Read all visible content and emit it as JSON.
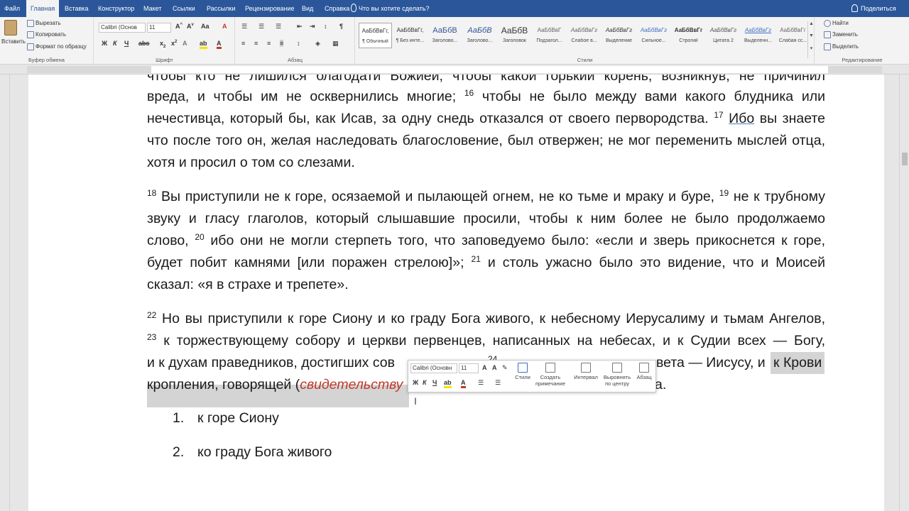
{
  "tabs": [
    {
      "label": "Файл",
      "active": false
    },
    {
      "label": "Главная",
      "active": true
    },
    {
      "label": "Вставка",
      "active": false
    },
    {
      "label": "Конструктор",
      "active": false
    },
    {
      "label": "Макет",
      "active": false
    },
    {
      "label": "Ссылки",
      "active": false
    },
    {
      "label": "Рассылки",
      "active": false
    },
    {
      "label": "Рецензирование",
      "active": false
    },
    {
      "label": "Вид",
      "active": false
    },
    {
      "label": "Справка",
      "active": false
    }
  ],
  "tell_me": "Что вы хотите сделать?",
  "share": "Поделиться",
  "clipboard": {
    "paste": "Вставить",
    "cut": "Вырезать",
    "copy": "Копировать",
    "format_painter": "Формат по образцу",
    "group_label": "Буфер обмена"
  },
  "font": {
    "family": "Calibri (Основ",
    "size": "11",
    "bold": "Ж",
    "italic": "К",
    "underline": "Ч",
    "group_label": "Шрифт"
  },
  "paragraph": {
    "group_label": "Абзац"
  },
  "styles": {
    "group_label": "Стили",
    "items": [
      {
        "preview": "АаБбВвГг,",
        "name": "¶ Обычный",
        "selected": true
      },
      {
        "preview": "АаБбВвГг,",
        "name": "¶ Без инте...",
        "selected": false
      },
      {
        "preview": "АаБбВ",
        "name": "Заголово...",
        "selected": false
      },
      {
        "preview": "АаБбВ",
        "name": "Заголово...",
        "selected": false
      },
      {
        "preview": "АаБбВ",
        "name": "Заголовок",
        "selected": false
      },
      {
        "preview": "АаБбВвГ",
        "name": "Подзагол...",
        "selected": false
      },
      {
        "preview": "АаБбВвГг",
        "name": "Слабое в...",
        "selected": false
      },
      {
        "preview": "АаБбВвГг",
        "name": "Выделение",
        "selected": false
      },
      {
        "preview": "АаБбВвГг",
        "name": "Сильное...",
        "selected": false
      },
      {
        "preview": "АаБбВвГг",
        "name": "Строгий",
        "selected": false
      },
      {
        "preview": "АаБбВвГг",
        "name": "Цитата 2",
        "selected": false
      },
      {
        "preview": "АаБбВвГг",
        "name": "Выделенн...",
        "selected": false
      },
      {
        "preview": "АаБбВвГг",
        "name": "Слабая сс...",
        "selected": false
      }
    ]
  },
  "editing": {
    "find": "Найти",
    "replace": "Заменить",
    "select": "Выделить",
    "group_label": "Редактирование"
  },
  "document": {
    "line0": "чтобы кто не лишился благодати Божией; чтобы какой горький корень, возникнув, не причинил",
    "line1a": "вреда, и чтобы им не осквернились многие; ",
    "sup16": "16",
    "line1b": " чтобы не было между вами какого блудника или",
    "line2a": "нечестивца, который бы, как Исав, за одну снедь отказался от своего первородства. ",
    "sup17": "17",
    "line2b": "Ибо",
    "line2c": " вы знаете",
    "line3": "что после того он, желая наследовать благословение, был отвержен; не мог переменить мыслей отца,",
    "line4": "хотя и просил о том со слезами.",
    "sup18": "18",
    "line5a": " Вы приступили не к горе, осязаемой и пылающей огнем, не ко тьме и мраку и буре, ",
    "sup19": "19",
    "line5b": " не к трубному",
    "line6": "звуку и гласу глаголов, который слышавшие просили, чтобы к ним более не было продолжаемо",
    "line7a": "слово, ",
    "sup20": "20",
    "line7b": " ибо они не могли стерпеть того, что заповедуемо было: «если и зверь прикоснется к горе,",
    "line8a": "будет побит камнями [или поражен стрелою]»; ",
    "sup21": "21",
    "line8b": " и столь ужасно было это видение, что и Моисей",
    "line9": "сказал: «я в страхе и трепете».",
    "sup22": "22",
    "line10": " Но вы приступили к горе Сиону и ко граду Бога живого, к небесному Иерусалиму и тьмам Ангелов,",
    "sup23": "23",
    "line11": " к торжествующему собору и церкви первенцев, написанных на небесах, и к Судии всех — Богу,",
    "line12a": "и к духам праведников, достигших сов",
    "sup24": "24",
    "line12b": "вета — Иисусу, и ",
    "line12c": "к Крови",
    "line13a": "кропления, говорящей (",
    "line13b": "свидетельству",
    "line13c": "а."
  },
  "list": [
    {
      "number": "1.",
      "text": "к горе Сиону"
    },
    {
      "number": "2.",
      "text": "ко граду Бога живого"
    }
  ],
  "mini_toolbar": {
    "font": "Calibri (Основн",
    "size": "11",
    "bold": "Ж",
    "italic": "К",
    "underline": "Ч",
    "styles": "Стили",
    "new_comment": "Создать примечание",
    "spacing": "Интервал",
    "center": "Выровнять по центру",
    "paragraph": "Абзац"
  }
}
